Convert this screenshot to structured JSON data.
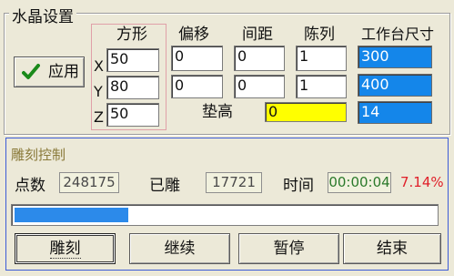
{
  "crystal": {
    "title": "水晶设置",
    "apply_label": "应用",
    "apply_icon": "checkmark-icon",
    "shape_label": "方形",
    "x_label": "X",
    "y_label": "Y",
    "z_label": "Z",
    "shape_x": "50",
    "shape_y": "80",
    "shape_z": "50",
    "offset_label": "偏移",
    "offset_1": "0",
    "offset_2": "0",
    "spacing_label": "间距",
    "spacing_1": "0",
    "spacing_2": "0",
    "array_label": "陈列",
    "array_1": "1",
    "array_2": "1",
    "table_size_label": "工作台尺寸",
    "table_x": "300",
    "table_y": "400",
    "table_z": "14",
    "padding_label": "垫高",
    "padding_value": "0"
  },
  "engrave": {
    "title": "雕刻控制",
    "points_label": "点数",
    "points_value": "248175",
    "done_label": "已雕",
    "done_value": "17721",
    "time_label": "时间",
    "time_value": "00:00:04",
    "percent": "7.14%",
    "progress_fraction": 0.0714,
    "engrave_button": "雕刻",
    "continue_button": "继续",
    "pause_button": "暂停",
    "end_button": "结束"
  },
  "colors": {
    "blue_field": "#1486ea",
    "yellow_field": "#ffff00",
    "percent_red": "#e0202a",
    "progress_blue": "#2c8aea"
  }
}
